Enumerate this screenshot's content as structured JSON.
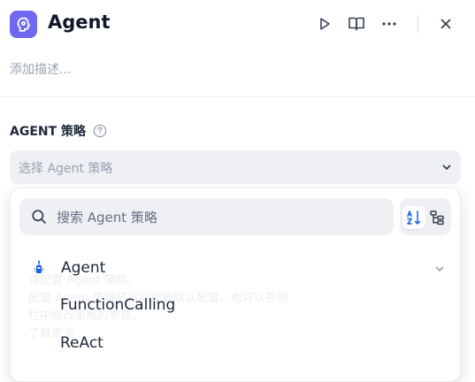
{
  "header": {
    "title": "Agent",
    "app_icon": "agent-app-icon",
    "actions": [
      "play-icon",
      "book-open-icon",
      "more-icon",
      "close-icon"
    ]
  },
  "description": {
    "placeholder": "添加描述..."
  },
  "strategy": {
    "label": "AGENT 策略",
    "select_placeholder": "选择 Agent 策略"
  },
  "dropdown": {
    "search_placeholder": "搜索 Agent 策略",
    "background_hint": [
      "请配置 Agent 策略。",
      "配置 Agent 策略将自动加载默认配置，也可以在侧",
      "栏中修改策略的参数。",
      "了解更多"
    ],
    "items": [
      {
        "label": "Agent",
        "icon": "agent-pin-icon",
        "expandable": true
      },
      {
        "label": "FunctionCalling"
      },
      {
        "label": "ReAct"
      }
    ]
  },
  "colors": {
    "accent": "#155eef",
    "brand_icon_bg": "#7068ef",
    "surface": "#eef0f4",
    "muted_text": "#98a2b3"
  }
}
